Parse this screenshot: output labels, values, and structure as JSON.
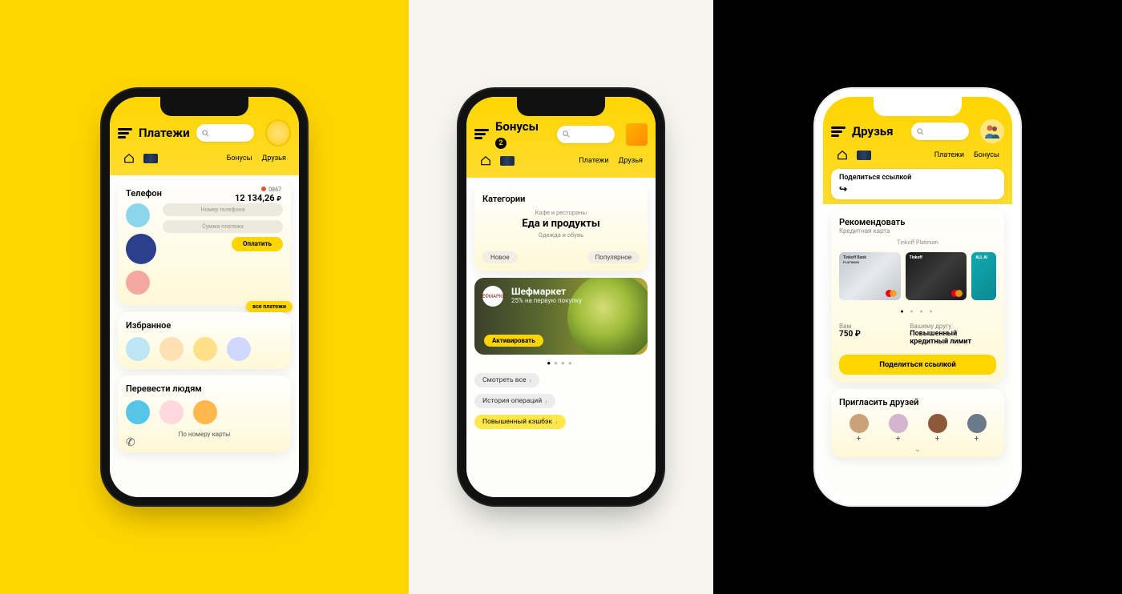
{
  "screen1": {
    "title": "Платежи",
    "nav": {
      "link1": "Бонусы",
      "link2": "Друзья"
    },
    "phone_card": {
      "title": "Телефон",
      "card_last": "0867",
      "balance": "12 134,26",
      "currency": "₽",
      "ph1": "Номер телефона",
      "ph2": "Сумма платежа",
      "pay": "Оплатить",
      "all": "все платежи"
    },
    "fav": {
      "title": "Избранное"
    },
    "transfer": {
      "title": "Перевести людям",
      "by_card": "По номеру карты"
    }
  },
  "screen2": {
    "title": "Бонусы",
    "badge": "2",
    "nav": {
      "link1": "Платежи",
      "link2": "Друзья"
    },
    "categories": {
      "title": "Категории",
      "sub1": "Кафе и рестораны",
      "main": "Еда и продукты",
      "sub2": "Одежда и обувь",
      "chip1": "Новое",
      "chip2": "Популярное"
    },
    "promo": {
      "brand": "ШЕФМАРКЕТ",
      "title": "Шефмаркет",
      "sub": "25% на первую покупку",
      "btn": "Активировать"
    },
    "links": {
      "l1": "Смотреть все",
      "l2": "История операций",
      "l3": "Повышенный кэшбэк"
    }
  },
  "screen3": {
    "title": "Друзья",
    "nav": {
      "link1": "Платежи",
      "link2": "Бонусы"
    },
    "share_top": "Поделиться ссылкой",
    "recommend": {
      "title": "Рекомендовать",
      "sub": "Кредитная карта",
      "product": "Tinkoff Platinum",
      "card_label1": "Tinkoff Bank",
      "card_label1b": "PLATINUM",
      "card_label2": "Tinkoff",
      "card_label3": "ALL AI",
      "you_label": "Вам",
      "you_value": "750",
      "you_cur": "₽",
      "friend_label": "Вашему другу",
      "friend_value": "Повышенный кредитный лимит",
      "share_btn": "Поделиться ссылкой"
    },
    "invite": {
      "title": "Пригласить друзей"
    }
  }
}
